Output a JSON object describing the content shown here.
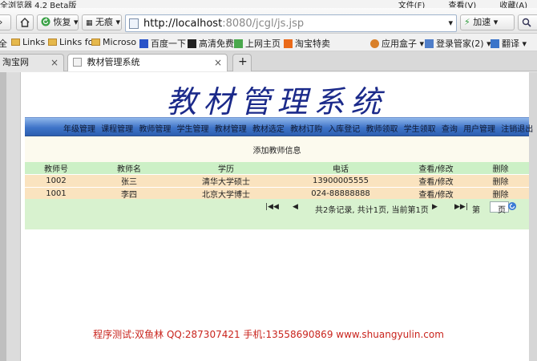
{
  "browser": {
    "title": "全浏览器 4.2 Beta版",
    "menu": [
      "文件(F)",
      "查看(V)",
      "收藏(A)"
    ],
    "buttons": {
      "back": "恢复",
      "noshadow": "无痕",
      "accelerate": "加速"
    },
    "url_host": "http://localhost",
    "url_rest": ":8080/jcgl/js.jsp",
    "bookmarks": [
      "Links",
      "Links fo",
      "Microso",
      "百度一下",
      "高清免费",
      "上网主页",
      "淘宝特卖"
    ],
    "bookmarks_right": [
      "应用盒子",
      "登录管家(2)",
      "翻译"
    ],
    "tabs": [
      {
        "label": "淘宝网",
        "active": false
      },
      {
        "label": "教材管理系统",
        "active": true
      }
    ]
  },
  "app": {
    "title": "教材管理系统",
    "menu_items": [
      "年级管理",
      "课程管理",
      "教师管理",
      "学生管理",
      "教材管理",
      "教材选定",
      "教材订购",
      "入库登记",
      "教师领取",
      "学生领取",
      "查询",
      "用户管理",
      "注销退出"
    ],
    "form_caption": "添加教师信息",
    "table": {
      "headers": [
        "教师号",
        "教师名",
        "学历",
        "电话",
        "查看/修改",
        "删除"
      ],
      "rows": [
        [
          "1002",
          "张三",
          "清华大学硕士",
          "13900005555",
          "查看/修改",
          "删除"
        ],
        [
          "1001",
          "李四",
          "北京大学博士",
          "024-88888888",
          "查看/修改",
          "删除"
        ]
      ]
    },
    "pager": {
      "summary": "共2条记录, 共计1页, 当前第1页",
      "go_prefix": "第",
      "go_suffix": "页"
    },
    "footer": "程序测试:双鱼林  QQ:287307421  手机:13558690869 www.shuangyulin.com"
  },
  "colors": {
    "menubar": "#3f74c8",
    "grid_header": "#ccf0c6",
    "grid_row": "#fae3bf",
    "title": "#1b2a8a",
    "footer": "#c9241d"
  }
}
